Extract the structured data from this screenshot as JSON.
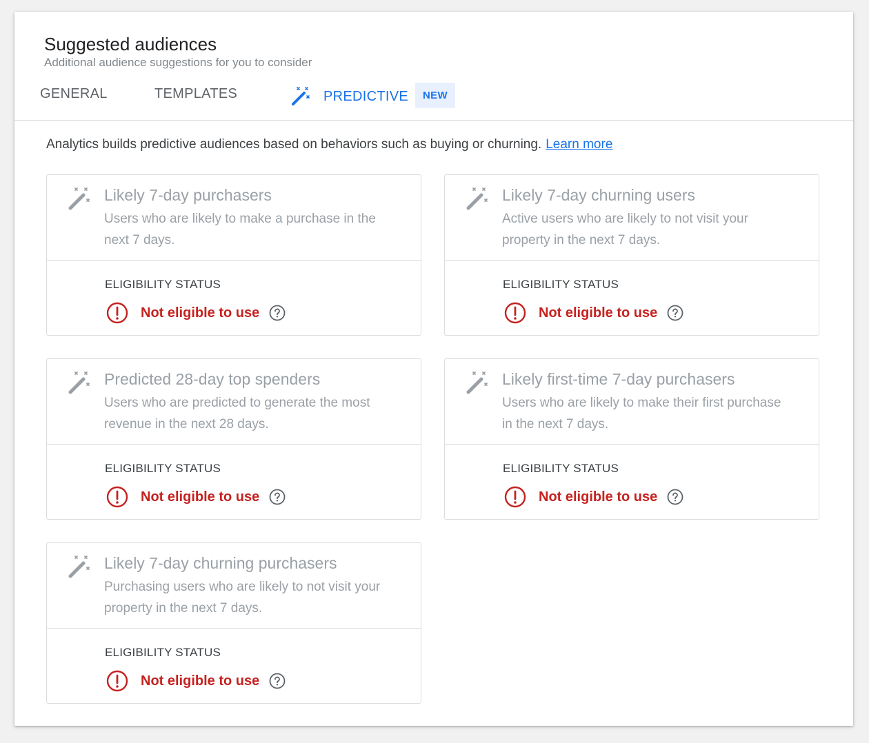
{
  "header": {
    "title": "Suggested audiences",
    "subtitle": "Additional audience suggestions for you to consider"
  },
  "tabs": [
    {
      "label": "GENERAL",
      "active": false
    },
    {
      "label": "TEMPLATES",
      "active": false
    },
    {
      "label": "PREDICTIVE",
      "active": true,
      "icon": "magic-wand-icon",
      "badge": "NEW"
    }
  ],
  "intro": {
    "text": "Analytics builds predictive audiences based on behaviors such as buying or churning.",
    "link": "Learn more"
  },
  "cards": [
    {
      "icon": "magic-wand-icon",
      "title": "Likely 7-day purchasers",
      "description": "Users who are likely to make a purchase in the next 7 days.",
      "eligibility_label": "ELIGIBILITY STATUS",
      "status": "Not eligible to use"
    },
    {
      "icon": "magic-wand-icon",
      "title": "Likely 7-day churning users",
      "description": "Active users who are likely to not visit your property in the next 7 days.",
      "eligibility_label": "ELIGIBILITY STATUS",
      "status": "Not eligible to use"
    },
    {
      "icon": "magic-wand-icon",
      "title": "Predicted 28-day top spenders",
      "description": "Users who are predicted to generate the most revenue in the next 28 days.",
      "eligibility_label": "ELIGIBILITY STATUS",
      "status": "Not eligible to use"
    },
    {
      "icon": "magic-wand-icon",
      "title": "Likely first-time 7-day purchasers",
      "description": "Users who are likely to make their first purchase in the next 7 days.",
      "eligibility_label": "ELIGIBILITY STATUS",
      "status": "Not eligible to use"
    },
    {
      "icon": "magic-wand-icon",
      "title": "Likely 7-day churning purchasers",
      "description": "Purchasing users who are likely to not visit your property in the next 7 days.",
      "eligibility_label": "ELIGIBILITY STATUS",
      "status": "Not eligible to use"
    }
  ],
  "colors": {
    "accent": "#1a73e8",
    "error": "#c5221f",
    "muted_text": "#9aa0a6",
    "badge_bg": "#e8f0fe"
  }
}
